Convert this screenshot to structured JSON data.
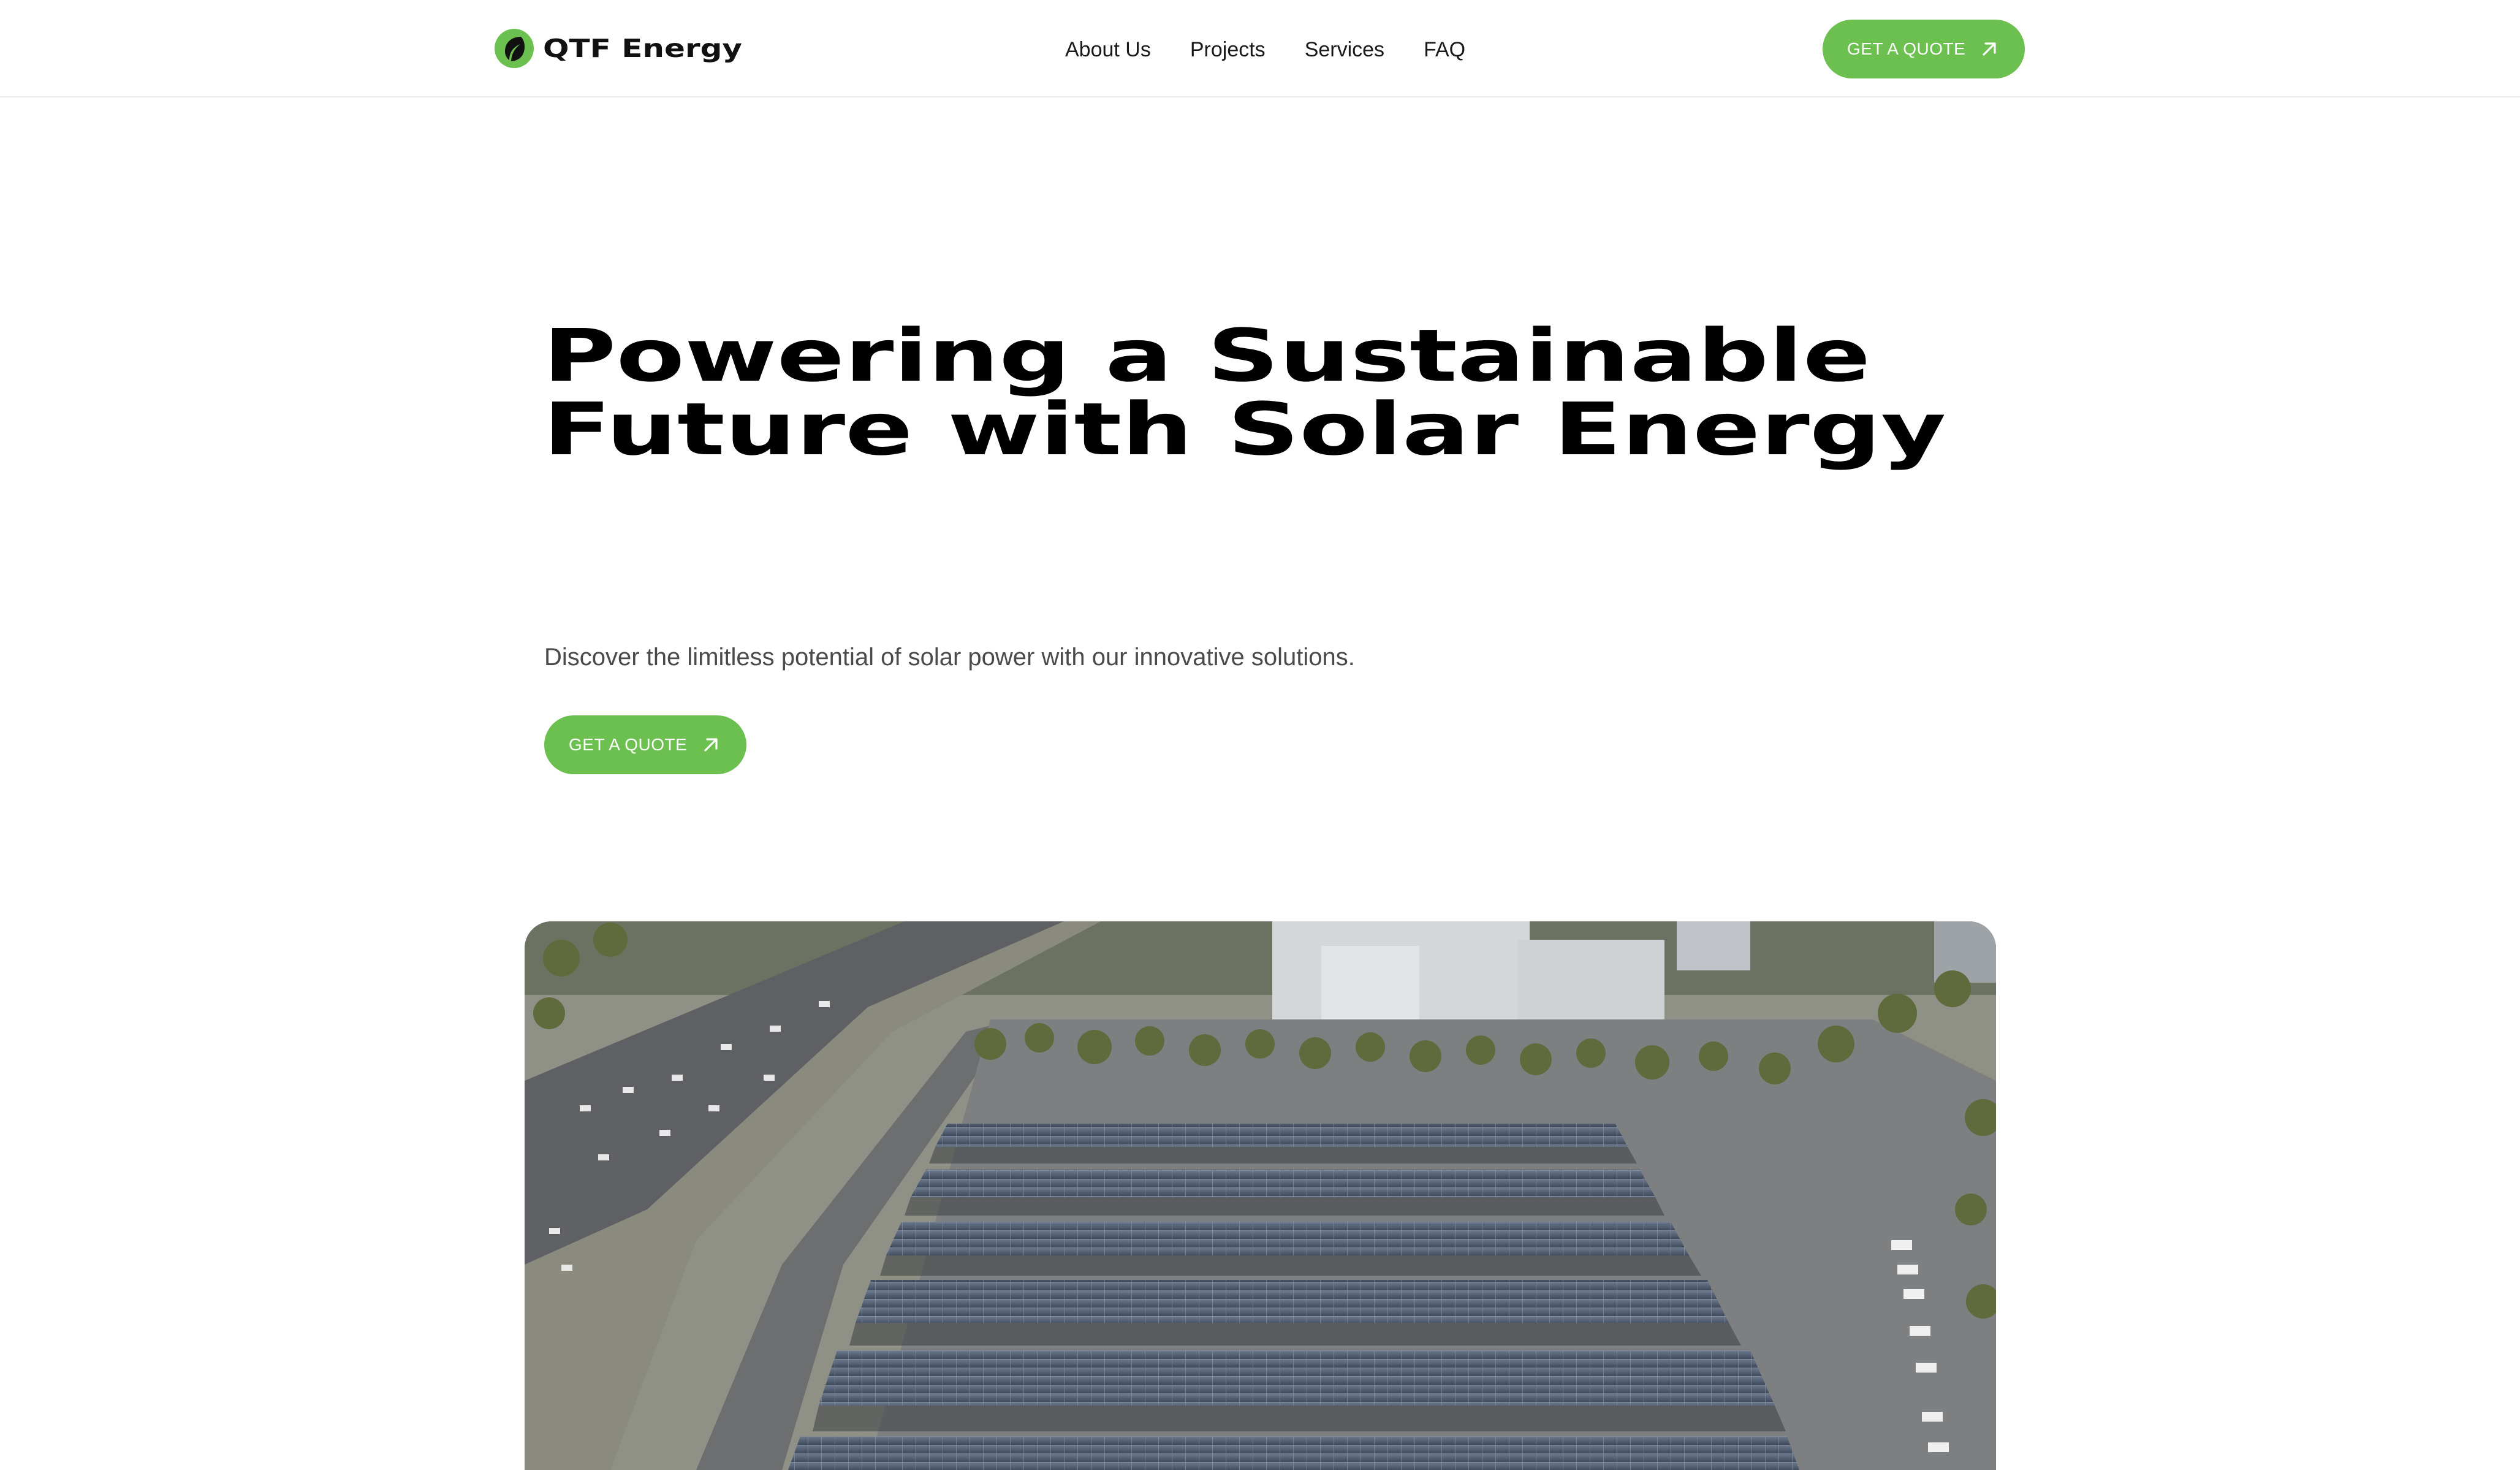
{
  "brand": {
    "name": "QTF Energy",
    "logo_icon": "leaf-circle-icon",
    "accent": "#6cc050"
  },
  "nav": {
    "items": [
      "About Us",
      "Projects",
      "Services",
      "FAQ"
    ]
  },
  "header_cta": {
    "label": "GET A QUOTE",
    "icon": "arrow-up-right-icon"
  },
  "hero": {
    "title": "Powering a Sustainable Future with Solar Energy",
    "subtitle": "Discover the limitless potential of solar power with our innovative solutions.",
    "cta": {
      "label": "GET A QUOTE",
      "icon": "arrow-up-right-icon"
    }
  },
  "hero_image": {
    "subject": "aerial-photo-solar-carport"
  }
}
